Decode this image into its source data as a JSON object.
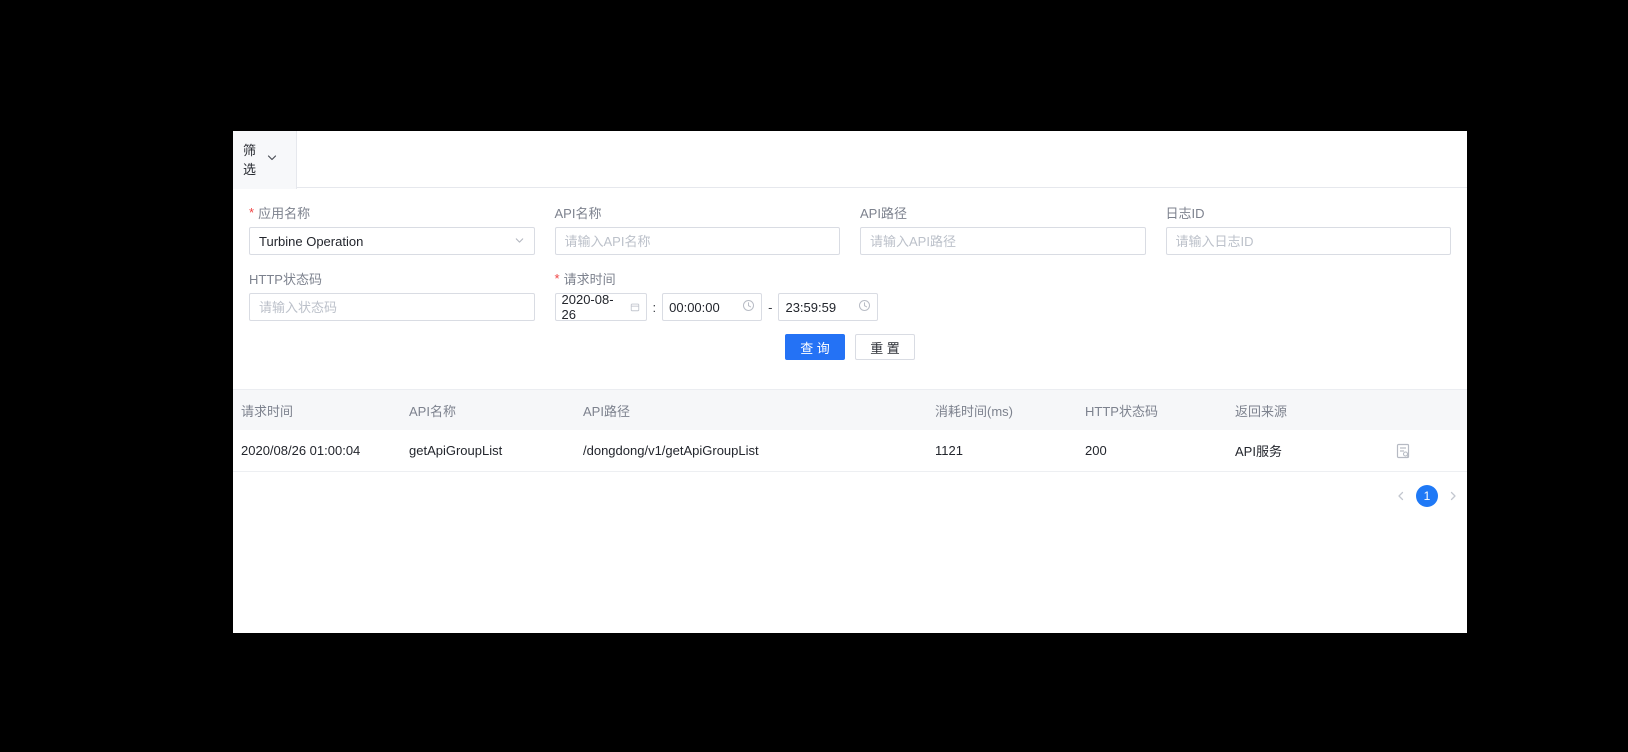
{
  "colors": {
    "page_bg": "#000000",
    "panel_bg": "#ffffff",
    "accent_blue": "#2472f5",
    "pager_blue": "#1f79f6",
    "tab_bg": "#f7f8fa",
    "table_header_bg": "#f6f7f9",
    "border": "#e6e8ed",
    "input_border": "#d9dce3",
    "label_text": "#7d828e",
    "value_text": "#23262d",
    "placeholder_text": "#bcc1ca",
    "required_red": "#f04343"
  },
  "required_marker": "*",
  "filter_tab": {
    "label": "筛选",
    "icon": "chevron-down-icon"
  },
  "filter": {
    "app_name": {
      "label": "应用名称",
      "value": "Turbine Operation",
      "icon": "chevron-down-icon"
    },
    "api_name": {
      "label": "API名称",
      "placeholder": "请输入API名称"
    },
    "api_path": {
      "label": "API路径",
      "placeholder": "请输入API路径"
    },
    "log_id": {
      "label": "日志ID",
      "placeholder": "请输入日志ID"
    },
    "http_status": {
      "label": "HTTP状态码",
      "placeholder": "请输入状态码"
    },
    "request_time": {
      "label": "请求时间",
      "date": "2020-08-26",
      "colon": ":",
      "start_time": "00:00:00",
      "dash": "-",
      "end_time": "23:59:59",
      "date_icon": "calendar-icon",
      "time_icon": "clock-icon"
    },
    "search_button": "查 询",
    "reset_button": "重 置"
  },
  "table": {
    "columns": [
      "请求时间",
      "API名称",
      "API路径",
      "消耗时间(ms)",
      "HTTP状态码",
      "返回来源",
      ""
    ],
    "rows": [
      {
        "request_time": "2020/08/26 01:00:04",
        "api_name": "getApiGroupList",
        "api_path": "/dongdong/v1/getApiGroupList",
        "elapsed_ms": "1121",
        "http_status": "200",
        "source": "API服务",
        "action_icon": "view-log-icon"
      }
    ]
  },
  "pagination": {
    "prev_icon": "chevron-left-icon",
    "current_page": "1",
    "next_icon": "chevron-right-icon"
  }
}
